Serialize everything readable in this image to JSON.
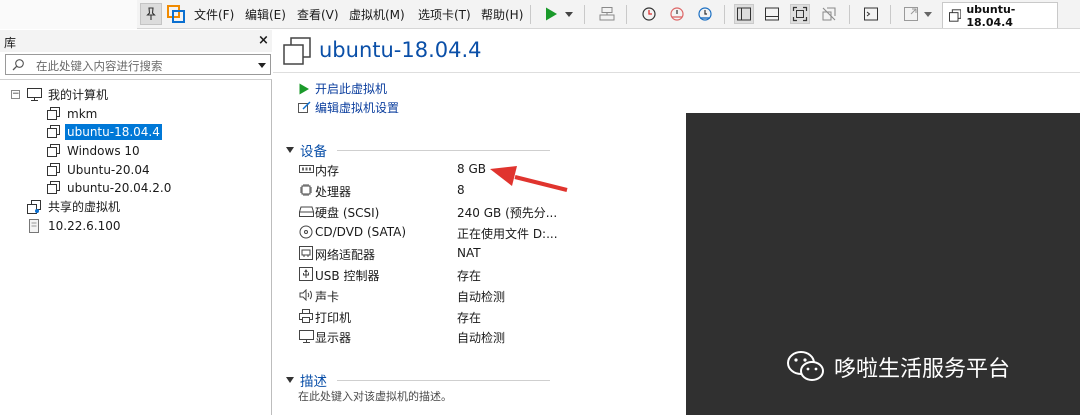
{
  "toolbar": {
    "menus": [
      "文件(F)",
      "编辑(E)",
      "查看(V)",
      "虚拟机(M)",
      "选项卡(T)",
      "帮助(H)"
    ],
    "tab_title": "ubuntu-18.04.4",
    "icons": [
      "pin-icon",
      "vmware-logo-icon",
      "play-icon",
      "send-ctrl-alt-del-icon",
      "snapshot-icon",
      "revert-snapshot-icon",
      "snapshot-manager-icon",
      "show-library-icon",
      "thumbnail-bar-icon",
      "full-screen-icon",
      "unity-icon",
      "console-view-icon",
      "stretch-view-icon"
    ]
  },
  "library": {
    "title": "库",
    "search_placeholder": "在此处键入内容进行搜索",
    "root": "我的计算机",
    "vms": [
      "mkm",
      "ubuntu-18.04.4",
      "Windows 10",
      "Ubuntu-20.04",
      "ubuntu-20.04.2.0"
    ],
    "selected_vm": "ubuntu-18.04.4",
    "shared": "共享的虚拟机",
    "remote_host": "10.22.6.100"
  },
  "main": {
    "vm_name": "ubuntu-18.04.4",
    "actions": [
      "开启此虚拟机",
      "编辑虚拟机设置"
    ],
    "devices_title": "设备",
    "devices": [
      {
        "name": "内存",
        "value": "8 GB",
        "icon": "memory-icon"
      },
      {
        "name": "处理器",
        "value": "8",
        "icon": "cpu-icon"
      },
      {
        "name": "硬盘 (SCSI)",
        "value": "240 GB (预先分...",
        "icon": "harddisk-icon"
      },
      {
        "name": "CD/DVD (SATA)",
        "value": "正在使用文件 D:...",
        "icon": "cd-dvd-icon"
      },
      {
        "name": "网络适配器",
        "value": "NAT",
        "icon": "network-adapter-icon"
      },
      {
        "name": "USB 控制器",
        "value": "存在",
        "icon": "usb-icon"
      },
      {
        "name": "声卡",
        "value": "自动检测",
        "icon": "sound-card-icon"
      },
      {
        "name": "打印机",
        "value": "存在",
        "icon": "printer-icon"
      },
      {
        "name": "显示器",
        "value": "自动检测",
        "icon": "display-icon"
      }
    ],
    "description_title": "描述",
    "description_placeholder": "在此处键入对该虚拟机的描述。"
  },
  "watermark": "哆啦生活服务平台",
  "colors": {
    "accent": "#0a4fa8",
    "selection": "#0078d7",
    "play": "#1a9a2a",
    "arrow": "#e0342e",
    "screen": "#303030"
  }
}
